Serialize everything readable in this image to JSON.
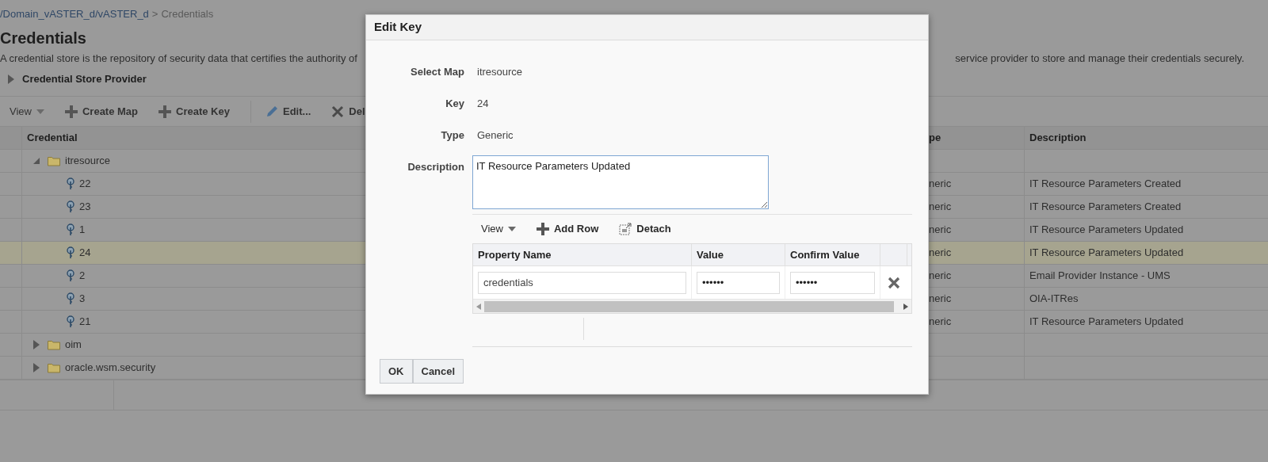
{
  "breadcrumb": {
    "link": "/Domain_vASTER_d/vASTER_d",
    "separator": ">",
    "current": "Credentials"
  },
  "page_title": "Credentials",
  "description": {
    "left": "A credential store is the repository of security data that certifies the authority of",
    "right": "service provider to store and manage their credentials securely."
  },
  "provider_section": {
    "label": "Credential Store Provider",
    "expanded": false
  },
  "toolbar": [
    {
      "kind": "menu",
      "label": "View"
    },
    {
      "kind": "add",
      "label": "Create Map"
    },
    {
      "kind": "add",
      "label": "Create Key"
    },
    {
      "kind": "edit",
      "label": "Edit..."
    },
    {
      "kind": "delete",
      "label": "Del"
    }
  ],
  "table": {
    "columns": [
      "Credential",
      "pe",
      "Description"
    ],
    "rows": [
      {
        "kind": "map",
        "name": "itresource",
        "expanded": true,
        "selected": false,
        "children": [
          {
            "kind": "key",
            "name": "22",
            "type": "neric",
            "description": "IT Resource Parameters Created",
            "selected": false
          },
          {
            "kind": "key",
            "name": "23",
            "type": "neric",
            "description": "IT Resource Parameters Created",
            "selected": false
          },
          {
            "kind": "key",
            "name": "1",
            "type": "neric",
            "description": "IT Resource Parameters Updated",
            "selected": false
          },
          {
            "kind": "key",
            "name": "24",
            "type": "neric",
            "description": "IT Resource Parameters Updated",
            "selected": true
          },
          {
            "kind": "key",
            "name": "2",
            "type": "neric",
            "description": "Email Provider Instance - UMS",
            "selected": false
          },
          {
            "kind": "key",
            "name": "3",
            "type": "neric",
            "description": "OIA-ITRes",
            "selected": false
          },
          {
            "kind": "key",
            "name": "21",
            "type": "neric",
            "description": "IT Resource Parameters Updated",
            "selected": false
          }
        ]
      },
      {
        "kind": "map",
        "name": "oim",
        "expanded": false,
        "selected": false
      },
      {
        "kind": "map",
        "name": "oracle.wsm.security",
        "expanded": false,
        "selected": false
      }
    ]
  },
  "dialog": {
    "title": "Edit Key",
    "fields": [
      {
        "kind": "text",
        "label": "Select Map",
        "value": "itresource"
      },
      {
        "kind": "text",
        "label": "Key",
        "value": "24"
      },
      {
        "kind": "text",
        "label": "Type",
        "value": "Generic"
      },
      {
        "kind": "textarea",
        "label": "Description",
        "value": "IT Resource Parameters Updated"
      }
    ],
    "properties": {
      "toolbar": [
        {
          "kind": "menu",
          "label": "View"
        },
        {
          "kind": "add",
          "label": "Add Row"
        },
        {
          "kind": "detach",
          "label": "Detach"
        }
      ],
      "columns": [
        "Property Name",
        "Value",
        "Confirm Value"
      ],
      "rows": [
        {
          "name": "credentials",
          "value": "••••••",
          "confirm": "••••••"
        }
      ]
    },
    "buttons": [
      "OK",
      "Cancel"
    ]
  }
}
